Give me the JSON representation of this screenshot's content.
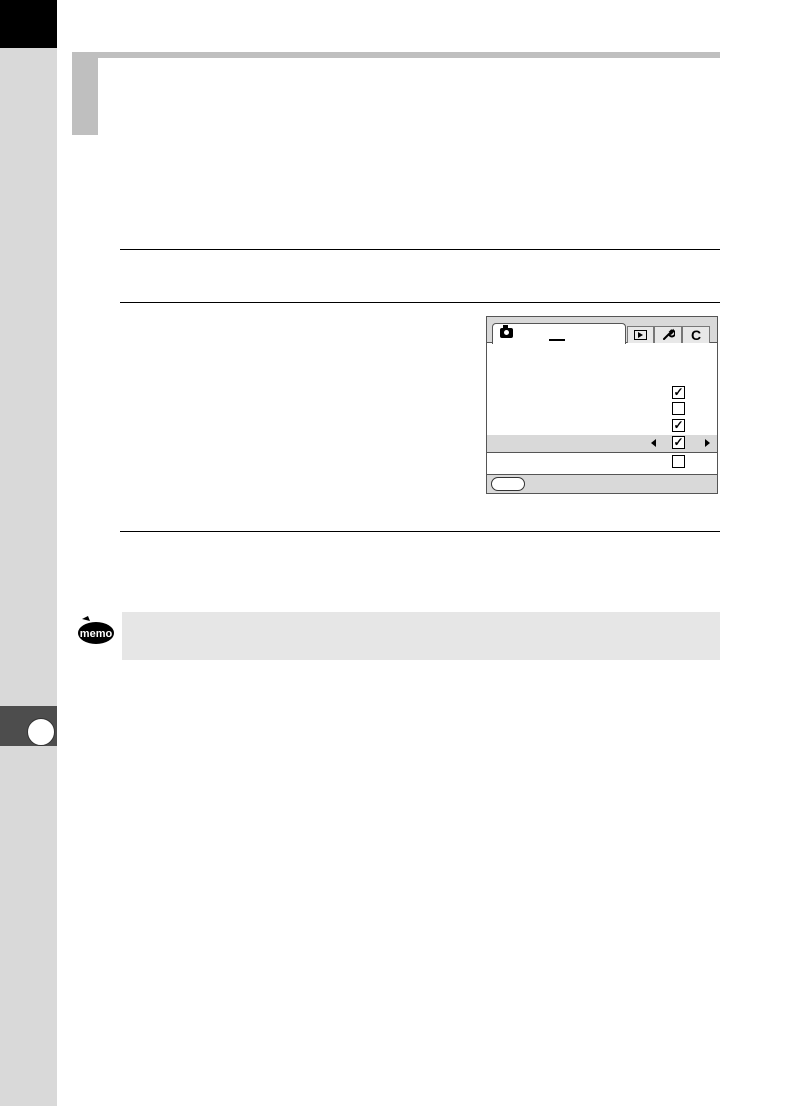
{
  "memo_icon": {
    "label": "memo"
  },
  "lcd": {
    "tabs": [
      "camera-tab",
      "playback-tab",
      "setup-tab",
      "custom-tab"
    ],
    "custom_tab_label": "C",
    "rows": [
      {
        "checked": true,
        "selected": false
      },
      {
        "checked": false,
        "selected": false
      },
      {
        "checked": true,
        "selected": false
      },
      {
        "checked": true,
        "selected": true
      },
      {
        "checked": false,
        "selected": false
      }
    ],
    "check_mark": "✓",
    "wrench_glyph": "🔧"
  },
  "colors": {
    "strip": "#d9d9d9",
    "header": "#bfbfbf",
    "memo_bg": "#e6e6e6",
    "chapter_tab": "#4d4d4d"
  }
}
